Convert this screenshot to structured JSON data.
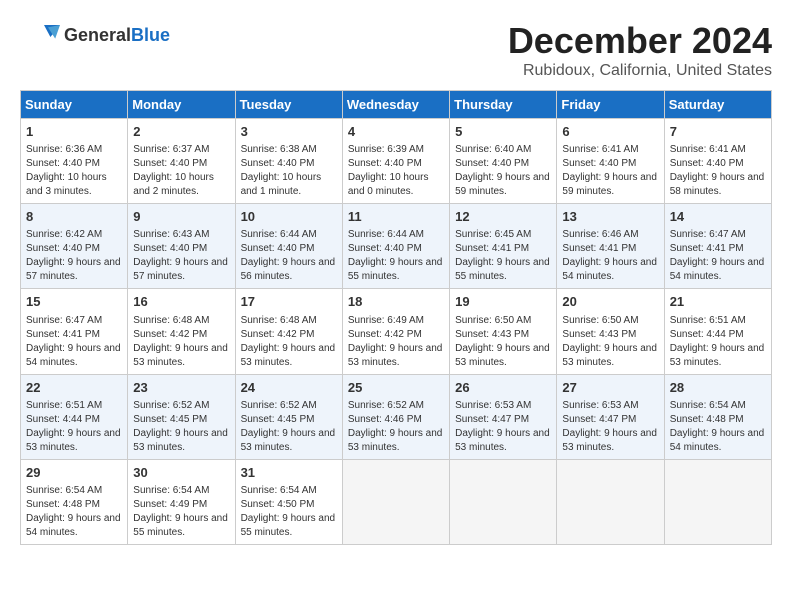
{
  "logo": {
    "general": "General",
    "blue": "Blue"
  },
  "title": "December 2024",
  "location": "Rubidoux, California, United States",
  "headers": [
    "Sunday",
    "Monday",
    "Tuesday",
    "Wednesday",
    "Thursday",
    "Friday",
    "Saturday"
  ],
  "weeks": [
    [
      {
        "day": "1",
        "sunrise": "6:36 AM",
        "sunset": "4:40 PM",
        "daylight": "10 hours and 3 minutes."
      },
      {
        "day": "2",
        "sunrise": "6:37 AM",
        "sunset": "4:40 PM",
        "daylight": "10 hours and 2 minutes."
      },
      {
        "day": "3",
        "sunrise": "6:38 AM",
        "sunset": "4:40 PM",
        "daylight": "10 hours and 1 minute."
      },
      {
        "day": "4",
        "sunrise": "6:39 AM",
        "sunset": "4:40 PM",
        "daylight": "10 hours and 0 minutes."
      },
      {
        "day": "5",
        "sunrise": "6:40 AM",
        "sunset": "4:40 PM",
        "daylight": "9 hours and 59 minutes."
      },
      {
        "day": "6",
        "sunrise": "6:41 AM",
        "sunset": "4:40 PM",
        "daylight": "9 hours and 59 minutes."
      },
      {
        "day": "7",
        "sunrise": "6:41 AM",
        "sunset": "4:40 PM",
        "daylight": "9 hours and 58 minutes."
      }
    ],
    [
      {
        "day": "8",
        "sunrise": "6:42 AM",
        "sunset": "4:40 PM",
        "daylight": "9 hours and 57 minutes."
      },
      {
        "day": "9",
        "sunrise": "6:43 AM",
        "sunset": "4:40 PM",
        "daylight": "9 hours and 57 minutes."
      },
      {
        "day": "10",
        "sunrise": "6:44 AM",
        "sunset": "4:40 PM",
        "daylight": "9 hours and 56 minutes."
      },
      {
        "day": "11",
        "sunrise": "6:44 AM",
        "sunset": "4:40 PM",
        "daylight": "9 hours and 55 minutes."
      },
      {
        "day": "12",
        "sunrise": "6:45 AM",
        "sunset": "4:41 PM",
        "daylight": "9 hours and 55 minutes."
      },
      {
        "day": "13",
        "sunrise": "6:46 AM",
        "sunset": "4:41 PM",
        "daylight": "9 hours and 54 minutes."
      },
      {
        "day": "14",
        "sunrise": "6:47 AM",
        "sunset": "4:41 PM",
        "daylight": "9 hours and 54 minutes."
      }
    ],
    [
      {
        "day": "15",
        "sunrise": "6:47 AM",
        "sunset": "4:41 PM",
        "daylight": "9 hours and 54 minutes."
      },
      {
        "day": "16",
        "sunrise": "6:48 AM",
        "sunset": "4:42 PM",
        "daylight": "9 hours and 53 minutes."
      },
      {
        "day": "17",
        "sunrise": "6:48 AM",
        "sunset": "4:42 PM",
        "daylight": "9 hours and 53 minutes."
      },
      {
        "day": "18",
        "sunrise": "6:49 AM",
        "sunset": "4:42 PM",
        "daylight": "9 hours and 53 minutes."
      },
      {
        "day": "19",
        "sunrise": "6:50 AM",
        "sunset": "4:43 PM",
        "daylight": "9 hours and 53 minutes."
      },
      {
        "day": "20",
        "sunrise": "6:50 AM",
        "sunset": "4:43 PM",
        "daylight": "9 hours and 53 minutes."
      },
      {
        "day": "21",
        "sunrise": "6:51 AM",
        "sunset": "4:44 PM",
        "daylight": "9 hours and 53 minutes."
      }
    ],
    [
      {
        "day": "22",
        "sunrise": "6:51 AM",
        "sunset": "4:44 PM",
        "daylight": "9 hours and 53 minutes."
      },
      {
        "day": "23",
        "sunrise": "6:52 AM",
        "sunset": "4:45 PM",
        "daylight": "9 hours and 53 minutes."
      },
      {
        "day": "24",
        "sunrise": "6:52 AM",
        "sunset": "4:45 PM",
        "daylight": "9 hours and 53 minutes."
      },
      {
        "day": "25",
        "sunrise": "6:52 AM",
        "sunset": "4:46 PM",
        "daylight": "9 hours and 53 minutes."
      },
      {
        "day": "26",
        "sunrise": "6:53 AM",
        "sunset": "4:47 PM",
        "daylight": "9 hours and 53 minutes."
      },
      {
        "day": "27",
        "sunrise": "6:53 AM",
        "sunset": "4:47 PM",
        "daylight": "9 hours and 53 minutes."
      },
      {
        "day": "28",
        "sunrise": "6:54 AM",
        "sunset": "4:48 PM",
        "daylight": "9 hours and 54 minutes."
      }
    ],
    [
      {
        "day": "29",
        "sunrise": "6:54 AM",
        "sunset": "4:48 PM",
        "daylight": "9 hours and 54 minutes."
      },
      {
        "day": "30",
        "sunrise": "6:54 AM",
        "sunset": "4:49 PM",
        "daylight": "9 hours and 55 minutes."
      },
      {
        "day": "31",
        "sunrise": "6:54 AM",
        "sunset": "4:50 PM",
        "daylight": "9 hours and 55 minutes."
      },
      null,
      null,
      null,
      null
    ]
  ]
}
